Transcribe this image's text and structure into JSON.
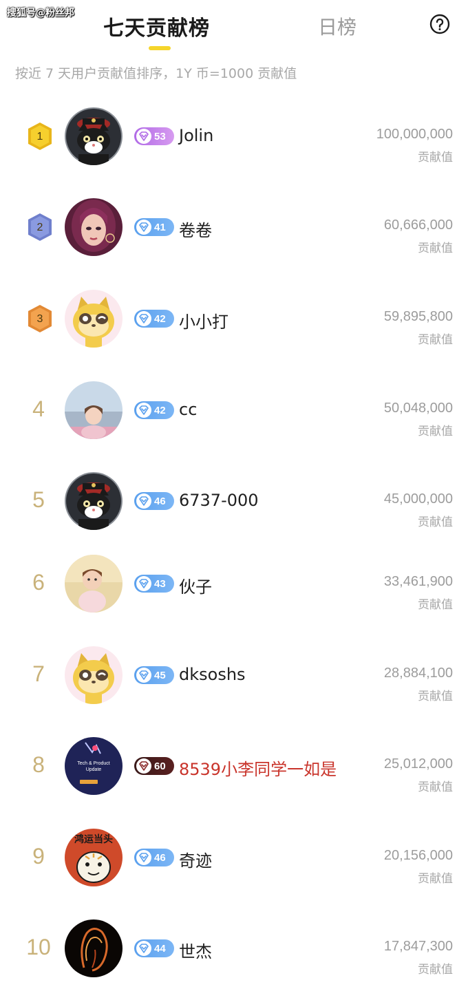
{
  "watermark": "搜狐号@粉丝邦",
  "tabs": {
    "active": "七天贡献榜",
    "inactive": "日榜"
  },
  "subtitle": "按近 7 天用户贡献值排序，1Y 币=1000 贡献值",
  "colors": {
    "accent": "#f5d52b",
    "rank_gold": "#c9b27a",
    "highlight_name": "#c9342b"
  },
  "score_label": "贡献值",
  "rows": [
    {
      "rank": "1",
      "name": "Jolin",
      "level": "53",
      "score": "100,000,000",
      "avatar": "cat-avatar"
    },
    {
      "rank": "2",
      "name": "卷卷",
      "level": "41",
      "score": "60,666,000",
      "avatar": "girl-portrait-avatar"
    },
    {
      "rank": "3",
      "name": "小小打",
      "level": "42",
      "score": "59,895,800",
      "avatar": "raccoon-avatar"
    },
    {
      "rank": "4",
      "name": "cc",
      "level": "42",
      "score": "50,048,000",
      "avatar": "child-photo-avatar"
    },
    {
      "rank": "5",
      "name": "6737-000",
      "level": "46",
      "score": "45,000,000",
      "avatar": "cat-avatar"
    },
    {
      "rank": "6",
      "name": "伙子",
      "level": "43",
      "score": "33,461,900",
      "avatar": "toddler-photo-avatar"
    },
    {
      "rank": "7",
      "name": "dksoshs",
      "level": "45",
      "score": "28,884,100",
      "avatar": "raccoon-avatar"
    },
    {
      "rank": "8",
      "name": "8539小李同学一如是",
      "level": "60",
      "score": "25,012,000",
      "avatar": "tech-update-avatar",
      "poster_text": "Tech & Product Update"
    },
    {
      "rank": "9",
      "name": "奇迹",
      "level": "46",
      "score": "20,156,000",
      "avatar": "cartoon-tiger-avatar",
      "poster_text": "鸿运当头"
    },
    {
      "rank": "10",
      "name": "世杰",
      "level": "44",
      "score": "17,847,300",
      "avatar": "fire-portrait-avatar"
    }
  ]
}
